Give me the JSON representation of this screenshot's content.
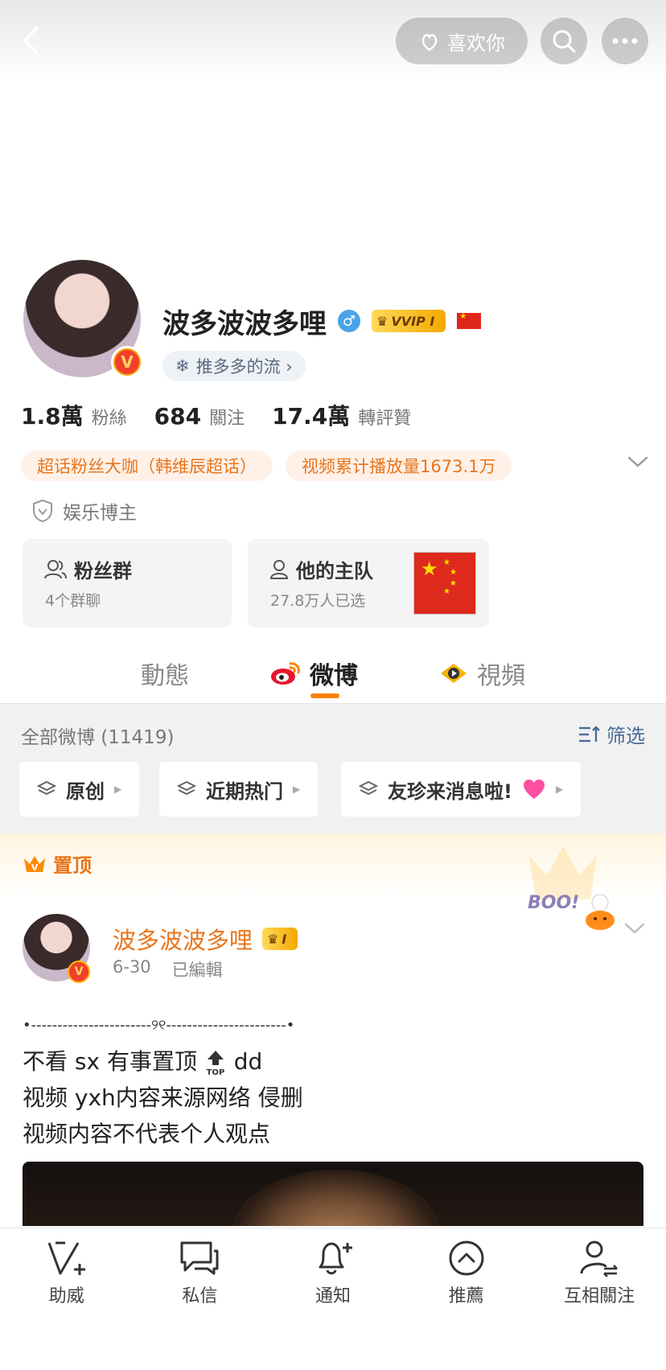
{
  "topbar": {
    "like_label": "喜欢你"
  },
  "profile": {
    "username": "波多波波多哩",
    "gender_symbol": "♂",
    "vip_label": "VVIP I",
    "topic_label": "推多多的流 ›",
    "stats": [
      {
        "num": "1.8萬",
        "label": "粉絲"
      },
      {
        "num": "684",
        "label": "關注"
      },
      {
        "num": "17.4萬",
        "label": "轉評贊"
      }
    ],
    "tags": [
      "超话粉丝大咖（韩维辰超话）",
      "视频累计播放量1673.1万"
    ],
    "role": "娱乐博主"
  },
  "cards": {
    "fans": {
      "title": "粉丝群",
      "sub": "4个群聊"
    },
    "team": {
      "title": "他的主队",
      "sub": "27.8万人已选"
    }
  },
  "tabs": [
    {
      "label": "動態"
    },
    {
      "label": "微博"
    },
    {
      "label": "視頻"
    }
  ],
  "filter": {
    "all_label": "全部微博 (11419)",
    "filter_label": "筛选",
    "chips": [
      "原创",
      "近期热门",
      "友珍来消息啦!"
    ]
  },
  "pinned": {
    "label": "置顶",
    "post": {
      "author": "波多波波多哩",
      "badge": "I",
      "date": "6-30",
      "edited": "已編輯",
      "boo_text": "BOO!",
      "lines": [
        "•-----------------------୨୧-----------------------•",
        "不看 sx 有事置顶",
        "dd",
        "视频 yxh内容来源网络 侵删",
        "视频内容不代表个人观点"
      ],
      "top_icon_text": "TOP"
    }
  },
  "bottom_bar": [
    {
      "label": "助威",
      "icon": "cheer-icon"
    },
    {
      "label": "私信",
      "icon": "message-icon"
    },
    {
      "label": "通知",
      "icon": "bell-icon"
    },
    {
      "label": "推薦",
      "icon": "recommend-icon"
    },
    {
      "label": "互相關注",
      "icon": "follow-icon"
    }
  ],
  "colors": {
    "accent": "#ff8200",
    "link": "#4a6d9a",
    "tag_text": "#e8751c"
  }
}
